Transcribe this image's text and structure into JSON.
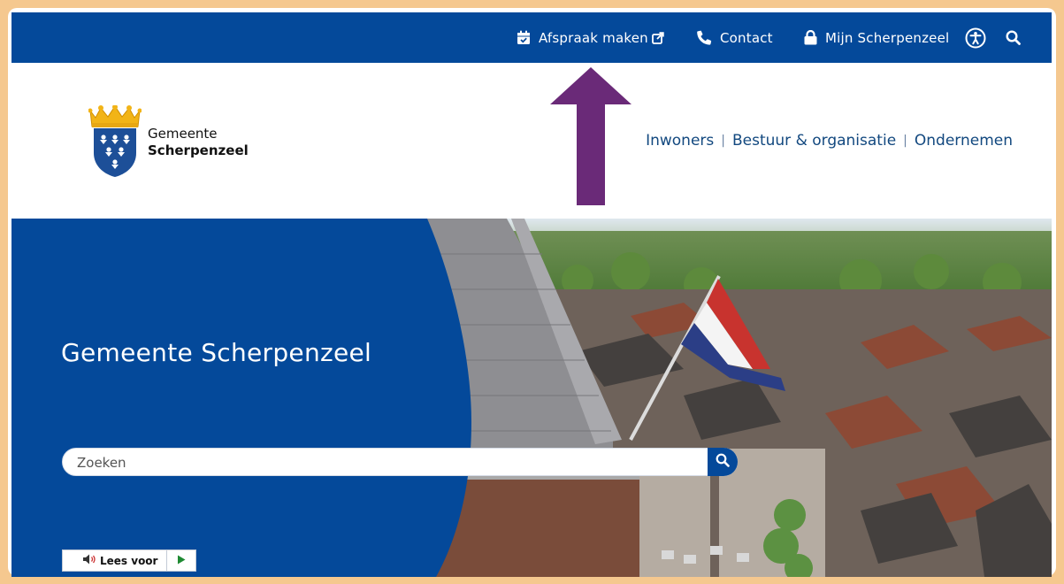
{
  "topbar": {
    "appointment_label": "Afspraak maken",
    "contact_label": "Contact",
    "account_label": "Mijn Scherpenzeel"
  },
  "logo": {
    "line1": "Gemeente",
    "line2": "Scherpenzeel"
  },
  "nav": {
    "items": [
      "Inwoners",
      "Bestuur & organisatie",
      "Ondernemen"
    ],
    "separator": "|"
  },
  "hero": {
    "title": "Gemeente Scherpenzeel",
    "search_placeholder": "Zoeken"
  },
  "readspeaker": {
    "label": "Lees voor"
  },
  "colors": {
    "brand_blue": "#04499a",
    "nav_text": "#12487f",
    "annotation_arrow": "#6a2a78",
    "frame_border": "#f5c88f"
  },
  "icons": [
    "calendar-check-icon",
    "external-link-icon",
    "phone-icon",
    "lock-icon",
    "accessibility-icon",
    "search-icon",
    "speaker-icon",
    "play-icon"
  ]
}
